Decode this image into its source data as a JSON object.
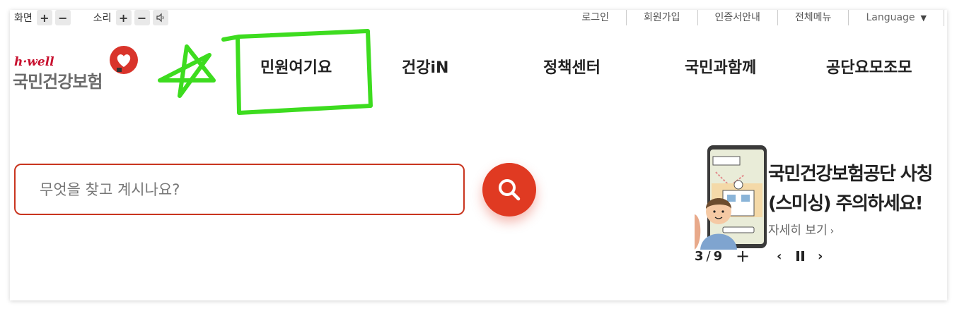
{
  "utility": {
    "screen_label": "화면",
    "sound_label": "소리",
    "plus": "+",
    "minus": "−",
    "links": [
      "로그인",
      "회원가입",
      "인증서안내",
      "전체메뉴"
    ],
    "language": "Language",
    "language_caret": "▼"
  },
  "logo": {
    "tagline": "h·well",
    "name": "국민건강보험"
  },
  "gnb": {
    "items": [
      "민원여기요",
      "건강iN",
      "정책센터",
      "국민과함께",
      "공단요모조모"
    ]
  },
  "search": {
    "placeholder": "무엇을 찾고 계시나요?",
    "value": ""
  },
  "banner": {
    "title_line1": "국민건강보험공단 사칭",
    "title_line2": "(스미싱) 주의하세요!",
    "more_label": "자세히 보기",
    "more_chevron": "›",
    "current": "3",
    "separator": "/",
    "total": "9",
    "plus": "+",
    "prev": "‹",
    "next": "›"
  },
  "colors": {
    "accent": "#e03a22",
    "brand_red": "#c8102e",
    "scribble": "#3ddc1f"
  }
}
